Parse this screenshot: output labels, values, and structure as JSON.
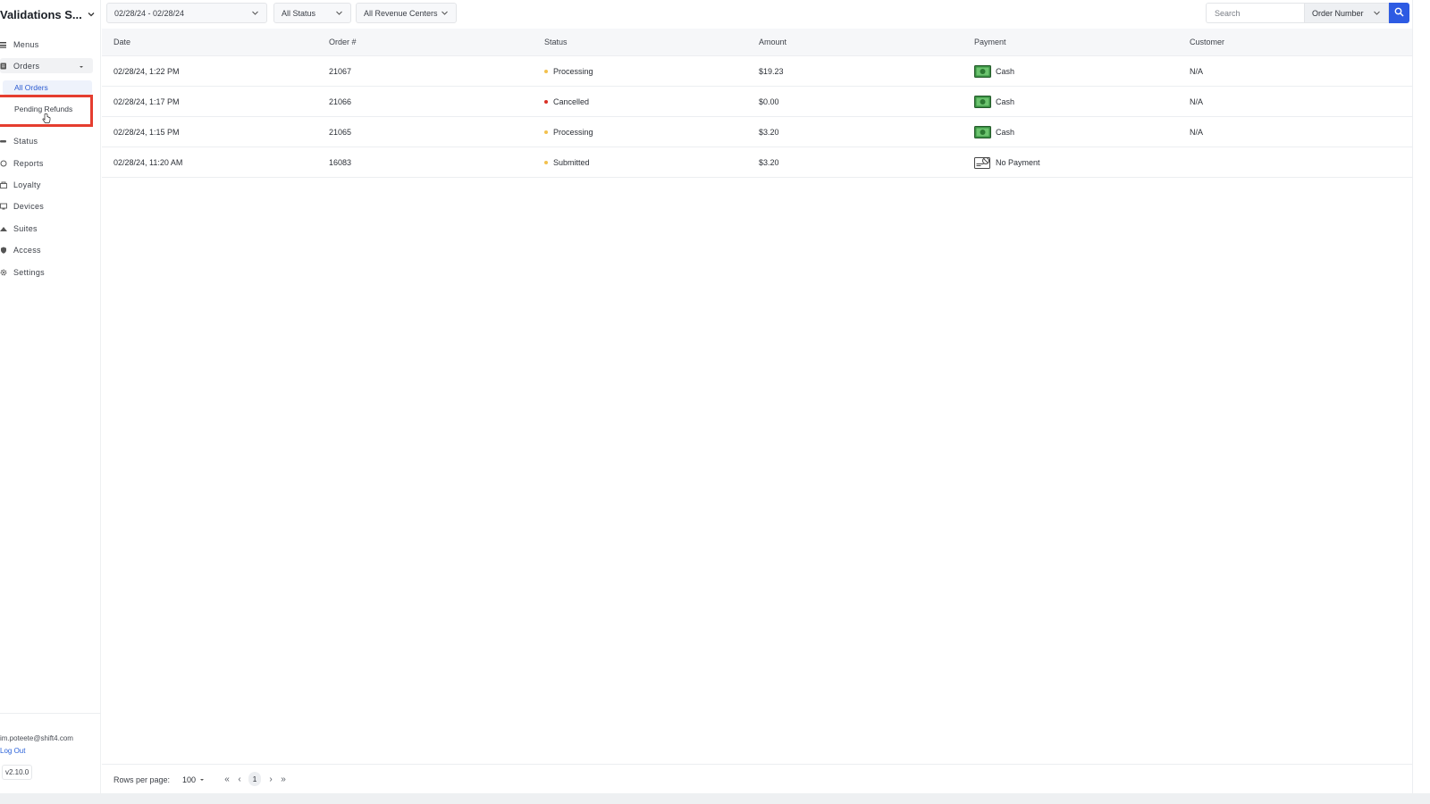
{
  "sidebar": {
    "brand": "Validations S...",
    "nav": [
      {
        "label": "Menus",
        "icon": "menus-icon"
      },
      {
        "label": "Orders",
        "icon": "orders-icon"
      },
      {
        "label": "Status",
        "icon": "status-icon"
      },
      {
        "label": "Reports",
        "icon": "reports-icon"
      },
      {
        "label": "Loyalty",
        "icon": "loyalty-icon"
      },
      {
        "label": "Devices",
        "icon": "devices-icon"
      },
      {
        "label": "Suites",
        "icon": "suites-icon"
      },
      {
        "label": "Access",
        "icon": "access-icon"
      },
      {
        "label": "Settings",
        "icon": "settings-icon"
      }
    ],
    "orders_sub": [
      "All Orders",
      "Pending Refunds"
    ],
    "user_email": "im.poteete@shift4.com",
    "logout": "Log Out",
    "version": "v2.10.0"
  },
  "filters": {
    "date_range": "02/28/24 - 02/28/24",
    "status": "All Status",
    "revenue_centers": "All Revenue Centers",
    "search_placeholder": "Search",
    "search_type": "Order Number"
  },
  "table": {
    "columns": [
      "Date",
      "Order #",
      "Status",
      "Amount",
      "Payment",
      "Customer"
    ],
    "rows": [
      {
        "date": "02/28/24, 1:22 PM",
        "order": "21067",
        "status": "Processing",
        "amount": "$19.23",
        "payment": "Cash",
        "customer": "N/A"
      },
      {
        "date": "02/28/24, 1:17 PM",
        "order": "21066",
        "status": "Cancelled",
        "amount": "$0.00",
        "payment": "Cash",
        "customer": "N/A"
      },
      {
        "date": "02/28/24, 1:15 PM",
        "order": "21065",
        "status": "Processing",
        "amount": "$3.20",
        "payment": "Cash",
        "customer": "N/A"
      },
      {
        "date": "02/28/24, 11:20 AM",
        "order": "16083",
        "status": "Submitted",
        "amount": "$3.20",
        "payment": "No Payment",
        "customer": ""
      }
    ]
  },
  "pagination": {
    "rows_per_page_label": "Rows per page:",
    "rows_per_page": "100",
    "current_page": "1"
  },
  "colors": {
    "accent": "#2d5be3",
    "processing": "#f2c14e",
    "cancelled": "#d93025",
    "submitted": "#f2c14e",
    "highlight": "#e53d2f"
  }
}
